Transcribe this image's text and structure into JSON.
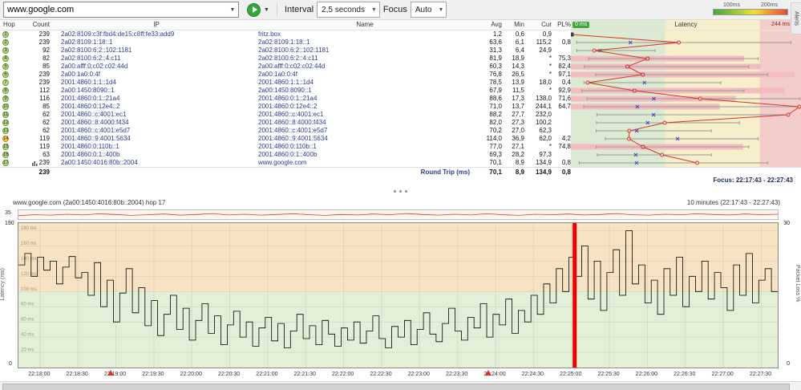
{
  "toolbar": {
    "target_value": "www.google.com",
    "interval_label": "Interval",
    "interval_value": "2,5 seconds",
    "focus_label": "Focus",
    "focus_value": "Auto",
    "legend": {
      "low": "100ms",
      "high": "200ms"
    },
    "alerts_tab": "Alerts"
  },
  "table": {
    "headers": {
      "hop": "Hop",
      "count": "Count",
      "ip": "IP",
      "name": "Name",
      "avg": "Avg",
      "min": "Min",
      "cur": "Cur",
      "pl": "PL%",
      "latency": "Latency"
    },
    "scale": {
      "zero": "0 ms",
      "max": "244 ms"
    },
    "rows": [
      {
        "hop": "1",
        "count": "239",
        "ip": "2a02:8109:c3f:fbd4:de15:c8ff:fe33:add9",
        "name": "fritz.box",
        "avg": "1,2",
        "min": "0,6",
        "cur": "0,9",
        "pl": "",
        "circle": "green",
        "icon": false
      },
      {
        "hop": "2",
        "count": "239",
        "ip": "2a02:8109:1:18::1",
        "name": "2a02:8109:1:18::1",
        "avg": "63,6",
        "min": "6,1",
        "cur": "115,2",
        "pl": "0,8",
        "circle": "green",
        "icon": false
      },
      {
        "hop": "3",
        "count": "92",
        "ip": "2a02:8100:6:2::102:1181",
        "name": "2a02:8100:6:2::102:1181",
        "avg": "31,3",
        "min": "6,4",
        "cur": "24,9",
        "pl": "",
        "circle": "green",
        "icon": false
      },
      {
        "hop": "4",
        "count": "82",
        "ip": "2a02:8100:6:2::4:c11",
        "name": "2a02:8100:6:2::4:c11",
        "avg": "81,9",
        "min": "18,9",
        "cur": "*",
        "pl": "75,3",
        "circle": "green",
        "icon": false
      },
      {
        "hop": "5",
        "count": "85",
        "ip": "2a00:afff:0:c02:c02:44d",
        "name": "2a00:afff:0:c02:c02:44d",
        "avg": "60,3",
        "min": "14,3",
        "cur": "*",
        "pl": "82,4",
        "circle": "green",
        "icon": false
      },
      {
        "hop": "6",
        "count": "239",
        "ip": "2a00:1a0:0:4f",
        "name": "2a00:1a0:0:4f",
        "avg": "76,8",
        "min": "26,5",
        "cur": "*",
        "pl": "97,1",
        "circle": "green",
        "icon": false
      },
      {
        "hop": "7",
        "count": "239",
        "ip": "2001:4860:1:1::1d4",
        "name": "2001:4860:1:1::1d4",
        "avg": "78,5",
        "min": "13,9",
        "cur": "18,0",
        "pl": "0,4",
        "circle": "green",
        "icon": false
      },
      {
        "hop": "8",
        "count": "112",
        "ip": "2a00:1450:8090::1",
        "name": "2a00:1450:8090::1",
        "avg": "67,9",
        "min": "11,5",
        "cur": "*",
        "pl": "92,9",
        "circle": "green",
        "icon": false
      },
      {
        "hop": "9",
        "count": "116",
        "ip": "2001:4860:0:1::21a4",
        "name": "2001:4860:0:1::21a4",
        "avg": "88,6",
        "min": "17,3",
        "cur": "138,0",
        "pl": "71,6",
        "circle": "green",
        "icon": false
      },
      {
        "hop": "10",
        "count": "85",
        "ip": "2001:4860:0:12e4::2",
        "name": "2001:4860:0:12e4::2",
        "avg": "71,0",
        "min": "13,7",
        "cur": "244,1",
        "pl": "64,7",
        "circle": "green",
        "icon": false
      },
      {
        "hop": "11",
        "count": "62",
        "ip": "2001:4860::c:4001:ec1",
        "name": "2001:4860::c:4001:ec1",
        "avg": "88,2",
        "min": "27,7",
        "cur": "232,0",
        "pl": "",
        "circle": "green",
        "icon": false
      },
      {
        "hop": "12",
        "count": "62",
        "ip": "2001:4860::8:4000:f434",
        "name": "2001:4860::8:4000:f434",
        "avg": "82,0",
        "min": "27,3",
        "cur": "100,2",
        "pl": "",
        "circle": "green",
        "icon": false
      },
      {
        "hop": "13",
        "count": "62",
        "ip": "2001:4860::c:4001:e5d7",
        "name": "2001:4860::c:4001:e5d7",
        "avg": "70,2",
        "min": "27,0",
        "cur": "62,3",
        "pl": "",
        "circle": "green",
        "icon": false
      },
      {
        "hop": "14",
        "count": "119",
        "ip": "2001:4860::9:4001:5634",
        "name": "2001:4860::9:4001:5634",
        "avg": "114,0",
        "min": "36,9",
        "cur": "62,0",
        "pl": "4,2",
        "circle": "orange",
        "icon": false
      },
      {
        "hop": "15",
        "count": "119",
        "ip": "2001:4860:0:110b::1",
        "name": "2001:4860:0:110b::1",
        "avg": "77,0",
        "min": "27,1",
        "cur": "*",
        "pl": "74,8",
        "circle": "green",
        "icon": false
      },
      {
        "hop": "16",
        "count": "63",
        "ip": "2001:4860:0:1::400b",
        "name": "2001:4860:0:1::400b",
        "avg": "69,3",
        "min": "28,2",
        "cur": "97,3",
        "pl": "",
        "circle": "green",
        "icon": false
      },
      {
        "hop": "17",
        "count": "239",
        "ip": "2a00:1450:4016:80b::2004",
        "name": "www.google.com",
        "avg": "70,1",
        "min": "8,9",
        "cur": "134,9",
        "pl": "0,8",
        "circle": "green",
        "icon": true
      }
    ],
    "footer": {
      "count": "239",
      "label": "Round Trip (ms)",
      "avg": "70,1",
      "min": "8,9",
      "cur": "134,9",
      "pl": "0,8"
    },
    "focus_text": "Focus: 22:17:43 - 22:27:43"
  },
  "chart_data": [
    {
      "type": "scatter",
      "title": "Latency",
      "xlabel": "ms",
      "xlim": [
        0,
        244
      ],
      "thresholds": [
        100,
        200
      ],
      "hops": [
        {
          "hop": 1,
          "min": 0.6,
          "avg": 1.2,
          "cur": 0.9,
          "max": 3,
          "loss": 0
        },
        {
          "hop": 2,
          "min": 6.1,
          "avg": 63.6,
          "cur": 115.2,
          "max": 235,
          "loss": 0.8
        },
        {
          "hop": 3,
          "min": 6.4,
          "avg": 31.3,
          "cur": 24.9,
          "max": 90,
          "loss": 0
        },
        {
          "hop": 4,
          "min": 18.9,
          "avg": 81.9,
          "cur": null,
          "max": 200,
          "loss": 75.3
        },
        {
          "hop": 5,
          "min": 14.3,
          "avg": 60.3,
          "cur": null,
          "max": 190,
          "loss": 82.4
        },
        {
          "hop": 6,
          "min": 26.5,
          "avg": 76.8,
          "cur": null,
          "max": 210,
          "loss": 97.1
        },
        {
          "hop": 7,
          "min": 13.9,
          "avg": 78.5,
          "cur": 18.0,
          "max": 160,
          "loss": 0.4
        },
        {
          "hop": 8,
          "min": 11.5,
          "avg": 67.9,
          "cur": null,
          "max": 185,
          "loss": 92.9
        },
        {
          "hop": 9,
          "min": 17.3,
          "avg": 88.6,
          "cur": 138.0,
          "max": 244,
          "loss": 71.6
        },
        {
          "hop": 10,
          "min": 13.7,
          "avg": 71.0,
          "cur": 244.1,
          "max": 244,
          "loss": 64.7
        },
        {
          "hop": 11,
          "min": 27.7,
          "avg": 88.2,
          "cur": 232.0,
          "max": 232,
          "loss": 0
        },
        {
          "hop": 12,
          "min": 27.3,
          "avg": 82.0,
          "cur": 100.2,
          "max": 180,
          "loss": 0
        },
        {
          "hop": 13,
          "min": 27.0,
          "avg": 70.2,
          "cur": 62.3,
          "max": 150,
          "loss": 0
        },
        {
          "hop": 14,
          "min": 36.9,
          "avg": 114.0,
          "cur": 62.0,
          "max": 200,
          "loss": 4.2
        },
        {
          "hop": 15,
          "min": 27.1,
          "avg": 77.0,
          "cur": null,
          "max": 190,
          "loss": 74.8
        },
        {
          "hop": 16,
          "min": 28.2,
          "avg": 69.3,
          "cur": 97.3,
          "max": 150,
          "loss": 0
        },
        {
          "hop": 17,
          "min": 8.9,
          "avg": 70.1,
          "cur": 134.9,
          "max": 210,
          "loss": 0.8
        }
      ]
    },
    {
      "type": "line",
      "title": "www.google.com (2a00:1450:4016:80b::2004) hop 17",
      "range_label": "10 minutes (22:17:43 - 22:27:43)",
      "ylabel_left": "Latency (ms)",
      "ylabel_right": "Packet Loss %",
      "ylim": [
        0,
        190
      ],
      "ylim_right": [
        0,
        30
      ],
      "y_grid_step": 20,
      "zone_boundary_ms": 100,
      "axis": {
        "left_top": "190",
        "left_bottom": "0",
        "right_top": "30",
        "right_bottom": "0",
        "overview_max": "35"
      },
      "x_ticks": [
        "22:18:00",
        "22:18:30",
        "22:19:00",
        "22:19:30",
        "22:20:00",
        "22:20:30",
        "22:21:00",
        "22:21:30",
        "22:22:00",
        "22:22:30",
        "22:23:00",
        "22:23:30",
        "22:24:00",
        "22:24:30",
        "22:25:00",
        "22:25:30",
        "22:26:00",
        "22:26:30",
        "22:27:00",
        "22:27:30"
      ],
      "x_tick_start_frac": 0.02833,
      "x_tick_step_frac": 0.05,
      "latency": [
        135,
        150,
        120,
        145,
        128,
        140,
        110,
        132,
        146,
        118,
        125,
        95,
        138,
        80,
        115,
        60,
        98,
        130,
        72,
        105,
        55,
        88,
        42,
        70,
        95,
        50,
        78,
        36,
        62,
        84,
        45,
        68,
        30,
        56,
        74,
        40,
        60,
        28,
        52,
        66,
        35,
        58,
        26,
        48,
        70,
        38,
        55,
        30,
        62,
        44,
        28,
        52,
        36,
        60,
        32,
        48,
        68,
        38,
        26,
        54,
        40,
        62,
        30,
        50,
        72,
        44,
        34,
        58,
        78,
        48,
        36,
        66,
        52,
        84,
        40,
        70,
        56,
        90,
        45,
        75,
        60,
        95,
        70,
        110,
        85,
        130,
        100,
        145,
        120,
        160,
        90,
        140,
        75,
        125,
        155,
        95,
        180,
        110,
        135,
        85,
        115,
        70,
        130,
        95,
        145,
        80,
        120,
        100,
        140,
        90,
        125,
        105,
        75,
        135,
        95,
        150,
        85,
        115,
        130,
        100
      ],
      "loss_event_frac": 0.732,
      "alert_fracs": [
        0.122,
        0.62
      ],
      "overview_values": [
        22,
        26,
        24,
        28,
        25,
        30,
        27,
        23,
        26,
        29,
        24,
        27,
        31,
        25,
        28,
        24,
        27,
        30,
        26,
        23,
        27,
        25,
        29,
        26,
        31,
        27,
        24,
        28,
        25,
        30,
        26,
        23,
        28,
        26,
        29,
        25,
        27,
        31,
        26,
        24,
        28,
        26,
        30,
        27,
        25,
        29,
        26,
        28
      ]
    }
  ]
}
